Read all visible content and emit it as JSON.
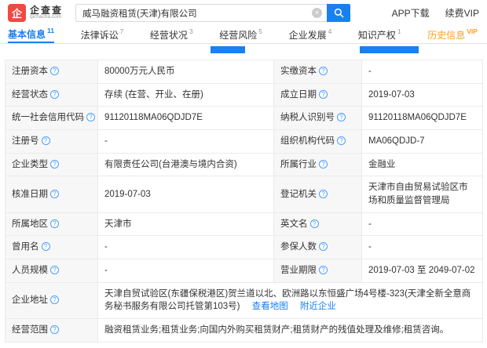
{
  "header": {
    "logo": {
      "icon_char": "企",
      "name": "企查查",
      "domain": "qichacha.com"
    },
    "search": {
      "value": "威马融资租赁(天津)有限公司"
    },
    "app_download": "APP下载",
    "renew_vip": "续费VIP"
  },
  "icons": {
    "help": "?",
    "clear": "×"
  },
  "colors": {
    "accent_blue": "#1a80f0",
    "vip_orange": "#ffa023",
    "logo_red": "#ee4a43"
  },
  "tabs": [
    {
      "label": "基本信息",
      "count": "11"
    },
    {
      "label": "法律诉讼",
      "count": "7"
    },
    {
      "label": "经营状况",
      "count": "3"
    },
    {
      "label": "经营风险",
      "count": "5"
    },
    {
      "label": "企业发展",
      "count": "4"
    },
    {
      "label": "知识产权",
      "count": "1"
    },
    {
      "label": "历史信息",
      "count": "VIP"
    }
  ],
  "table": {
    "rows": [
      {
        "l1": "注册资本",
        "v1": "80000万元人民币",
        "l2": "实缴资本",
        "v2": "-"
      },
      {
        "l1": "经营状态",
        "v1": "存续 (在营、开业、在册)",
        "l2": "成立日期",
        "v2": "2019-07-03"
      },
      {
        "l1": "统一社会信用代码",
        "v1": "91120118MA06QDJD7E",
        "l2": "纳税人识别号",
        "v2": "91120118MA06QDJD7E"
      },
      {
        "l1": "注册号",
        "v1": "-",
        "l2": "组织机构代码",
        "v2": "MA06QDJD-7"
      },
      {
        "l1": "企业类型",
        "v1": "有限责任公司(台港澳与境内合资)",
        "l2": "所属行业",
        "v2": "金融业"
      },
      {
        "l1": "核准日期",
        "v1": "2019-07-03",
        "l2": "登记机关",
        "v2": "天津市自由贸易试验区市场和质量监督管理局"
      },
      {
        "l1": "所属地区",
        "v1": "天津市",
        "l2": "英文名",
        "v2": "-"
      },
      {
        "l1": "曾用名",
        "v1": "-",
        "l2": "参保人数",
        "v2": "-"
      },
      {
        "l1": "人员规模",
        "v1": "-",
        "l2": "营业期限",
        "v2": "2019-07-03 至 2049-07-02"
      }
    ],
    "address": {
      "label": "企业地址",
      "value": "天津自贸试验区(东疆保税港区)贺兰道以北、欧洲路以东恒盛广场4号楼-323(天津全新全意商务秘书服务有限公司托管第103号)",
      "link_map": "查看地图",
      "link_nearby": "附近企业"
    },
    "scope": {
      "label": "经营范围",
      "value": "融资租赁业务;租赁业务;向国内外购买租赁财产;租赁财产的残值处理及维修;租赁咨询。"
    }
  }
}
